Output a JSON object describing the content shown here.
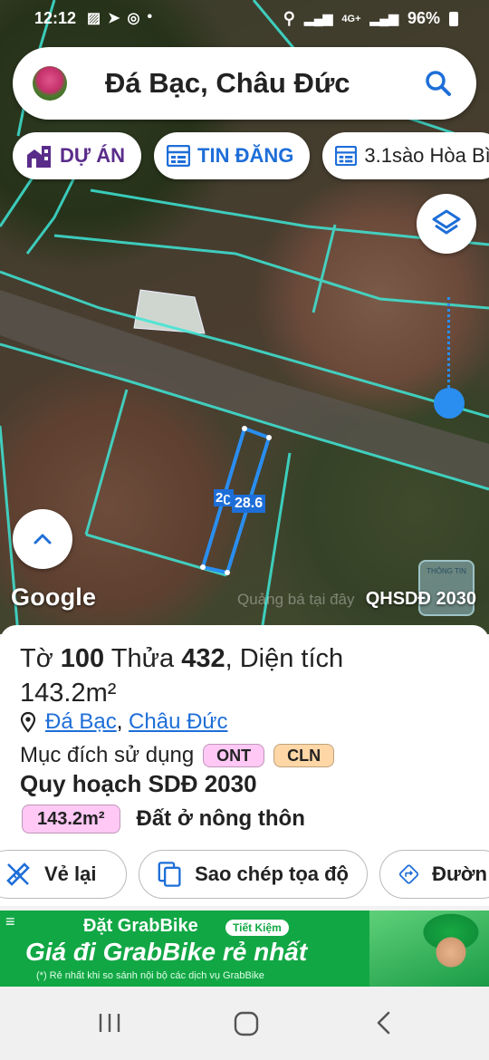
{
  "status_bar": {
    "time": "12:12",
    "battery": "96%",
    "network": "4G+"
  },
  "search": {
    "title": "Đá Bạc, Châu Đức"
  },
  "chips": {
    "du_an": "DỰ ÁN",
    "tin_dang": "TIN ĐĂNG",
    "listing": "3.1sào Hòa Bì"
  },
  "map": {
    "google": "Google",
    "watermark": "Quảng bá tại đây",
    "plan_label": "QHSDĐ 2030",
    "dimension_label": "28.6",
    "dimension_label_partial": "2ʗ",
    "stamp_text": "THÔNG TIN"
  },
  "plot": {
    "to_label": "Tờ",
    "to_value": "100",
    "thua_label": "Thửa",
    "thua_value": "432",
    "dien_tich_label": ", Diện tích",
    "area": "143.2m²",
    "location_1": "Đá Bạc",
    "location_sep": ",",
    "location_2": "Châu Đức",
    "purpose_label": "Mục đích sử dụng",
    "purpose_codes": [
      "ONT",
      "CLN"
    ],
    "plan_title": "Quy hoạch SDĐ 2030",
    "plan_area": "143.2m²",
    "plan_land_type": "Đất ở nông thôn"
  },
  "actions": {
    "redraw": "Vẻ lại",
    "copy_coords": "Sao chép tọa độ",
    "directions": "Đườn"
  },
  "ad": {
    "line1": "Đặt GrabBike",
    "tag": "Tiết Kiệm",
    "line2": "Giá đi GrabBike rẻ nhất",
    "line3": "(*) Rẻ nhất khi so sánh nội bộ các dịch vụ GrabBike"
  },
  "colors": {
    "accent_blue": "#1e6ed8",
    "brand_purple": "#5a2c8a",
    "parcel_line": "#3ee6d6",
    "grab_green": "#12a745"
  }
}
